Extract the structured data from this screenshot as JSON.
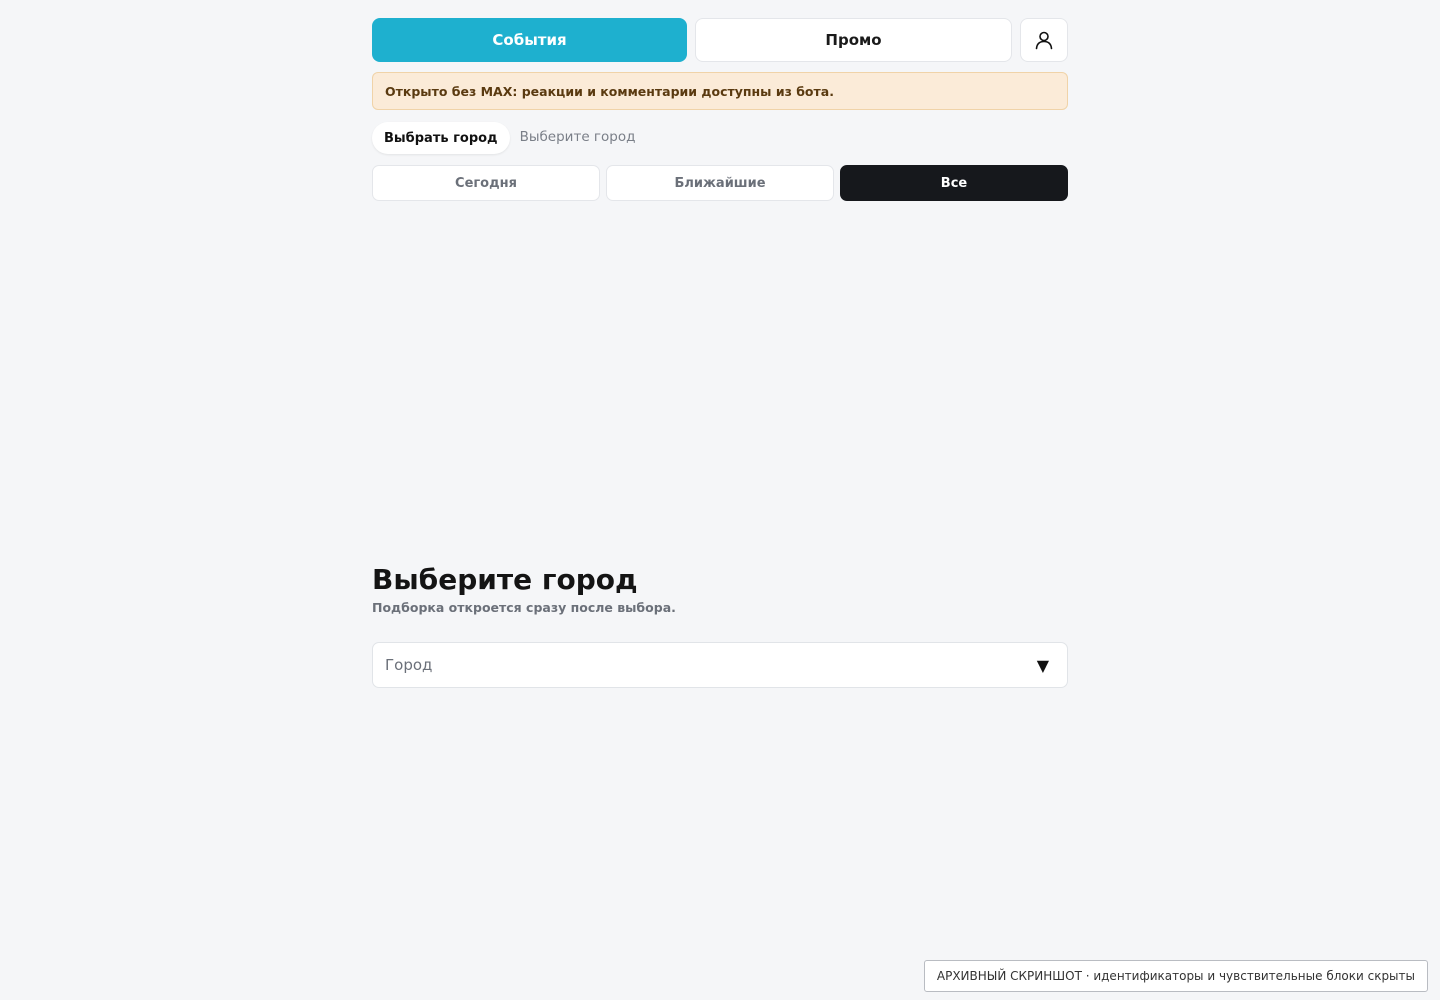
{
  "topbar": {
    "events_label": "События",
    "promo_label": "Промо",
    "profile_icon": "user-icon"
  },
  "notice": {
    "text": "Открыто без MAX: реакции и комментарии доступны из бота."
  },
  "city": {
    "choose_label": "Выбрать город",
    "current": "Выберите город"
  },
  "filters": {
    "today": "Сегодня",
    "nearest": "Ближайшие",
    "all": "Все",
    "active": "all"
  },
  "picker": {
    "title": "Выберите город",
    "subtitle": "Подборка откроется сразу после выбора.",
    "placeholder": "Город",
    "arrow": "▼"
  },
  "footer": {
    "archive_note": "АРХИВНЫЙ СКРИНШОТ · идентификаторы и чувствительные блоки скрыты"
  },
  "colors": {
    "accent": "#1eb0cf",
    "active_filter": "#16181c",
    "notice_bg": "#fbebd8",
    "background": "#f5f6f8"
  }
}
